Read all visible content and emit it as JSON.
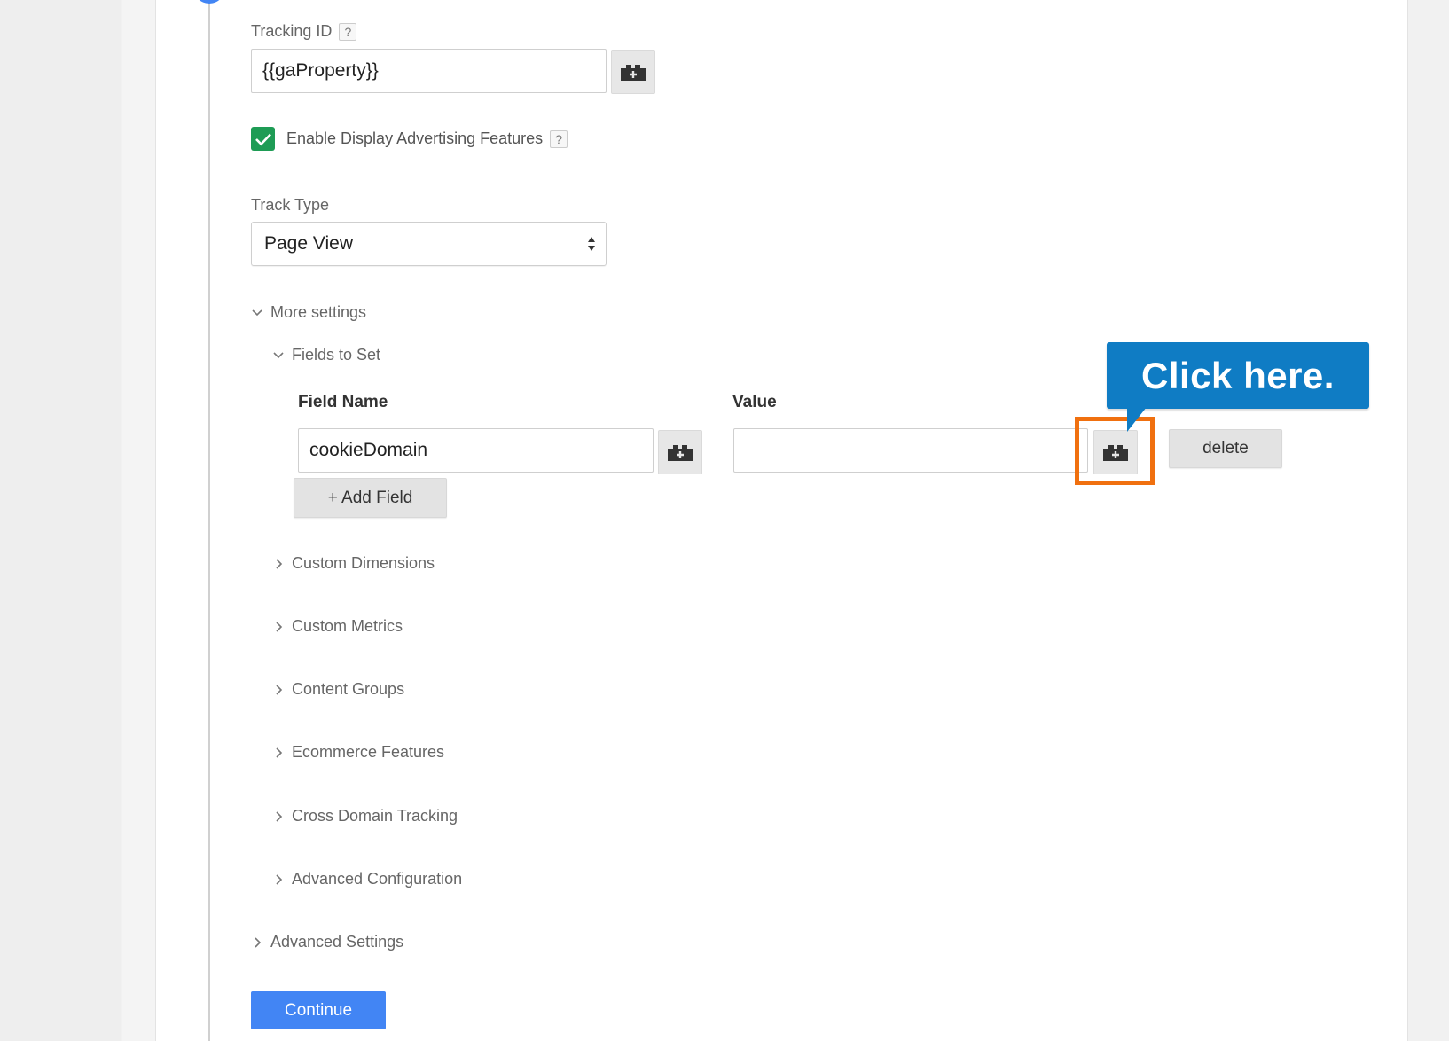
{
  "tracking_id": {
    "label": "Tracking ID",
    "help": "?",
    "value": "{{gaProperty}}"
  },
  "display_advertising": {
    "checked": true,
    "label": "Enable Display Advertising Features",
    "help": "?"
  },
  "track_type": {
    "label": "Track Type",
    "selected": "Page View"
  },
  "more_settings": {
    "label": "More settings",
    "expanded": true
  },
  "fields_to_set": {
    "label": "Fields to Set",
    "expanded": true,
    "column_field_name": "Field Name",
    "column_value": "Value",
    "rows": [
      {
        "field_name": "cookieDomain",
        "value": ""
      }
    ],
    "delete_label": "delete",
    "add_field_label": "+ Add Field"
  },
  "collapsed_sections": [
    "Custom Dimensions",
    "Custom Metrics",
    "Content Groups",
    "Ecommerce Features",
    "Cross Domain Tracking",
    "Advanced Configuration"
  ],
  "advanced_settings": {
    "label": "Advanced Settings"
  },
  "continue_label": "Continue",
  "callout": {
    "text": "Click here."
  },
  "colors": {
    "accent_blue": "#4285f4",
    "check_green": "#1e9c55",
    "callout_blue": "#0f7cc4",
    "highlight_orange": "#f0700f"
  },
  "icons": {
    "variable_button": "add-variable-icon",
    "checkbox": "checkmark-icon",
    "select": "updown-arrows-icon",
    "expanded": "chevron-down-icon",
    "collapsed": "chevron-right-icon"
  }
}
